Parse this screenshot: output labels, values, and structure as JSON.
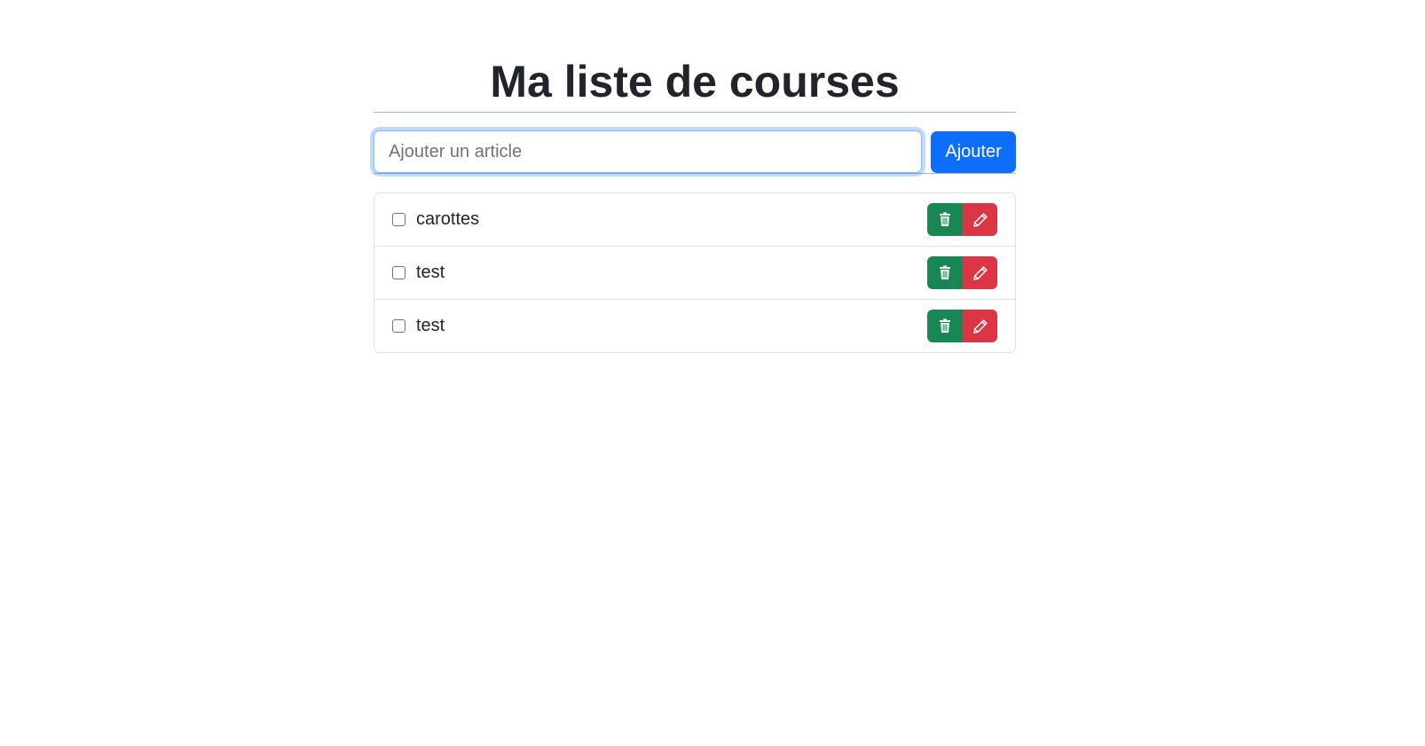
{
  "header": {
    "title": "Ma liste de courses"
  },
  "add_form": {
    "placeholder": "Ajouter un article",
    "value": "",
    "button_label": "Ajouter"
  },
  "items": [
    {
      "label": "carottes",
      "checked": false
    },
    {
      "label": "test",
      "checked": false
    },
    {
      "label": "test",
      "checked": false
    }
  ],
  "icons": {
    "delete": "trash-icon",
    "edit": "pencil-icon"
  },
  "colors": {
    "primary": "#0d6efd",
    "success": "#198754",
    "danger": "#dc3545",
    "text": "#212529"
  }
}
